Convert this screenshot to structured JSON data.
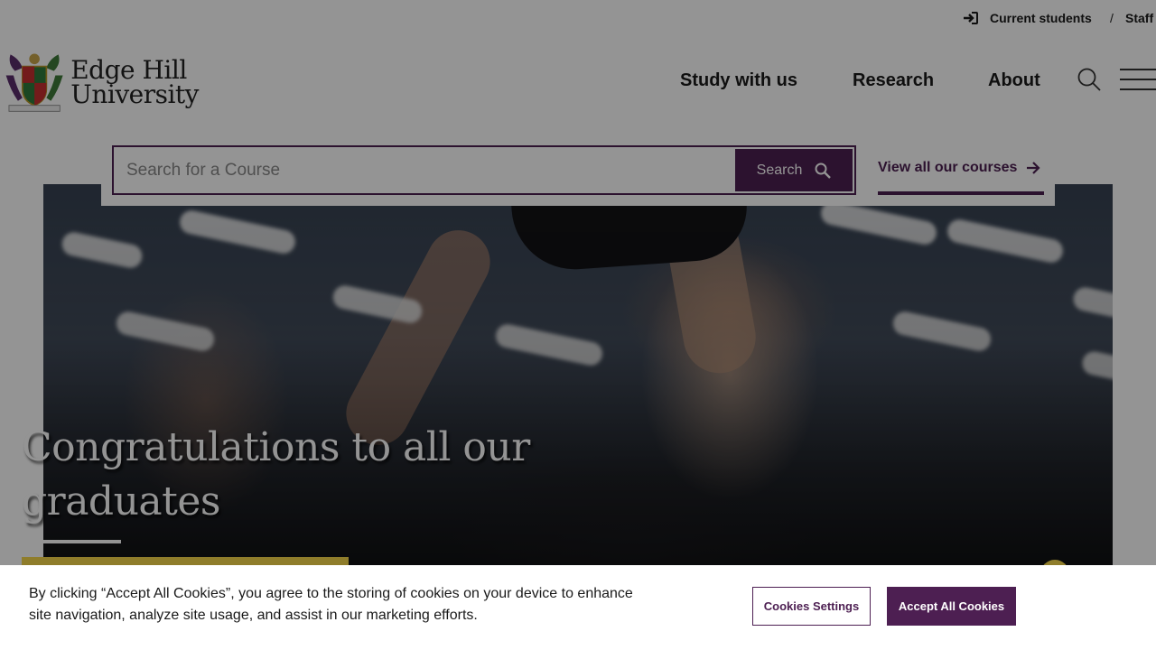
{
  "utility": {
    "current_students": "Current students",
    "separator": "/",
    "staff": "Staff"
  },
  "logo": {
    "line1": "Edge Hill",
    "line2": "University"
  },
  "nav": {
    "study": "Study with us",
    "research": "Research",
    "about": "About"
  },
  "course_search": {
    "placeholder": "Search for a Course",
    "button_label": "Search",
    "view_all": "View all our courses"
  },
  "hero": {
    "title": "Congratulations to all our graduates"
  },
  "cookie": {
    "message": "By clicking “Accept All Cookies”, you agree to the storing of cookies on your device to enhance site navigation, analyze site usage, and assist in our marketing efforts.",
    "settings_label": "Cookies Settings",
    "accept_label": "Accept All Cookies"
  },
  "colors": {
    "brand_purple": "#4d1f52",
    "accent_yellow": "#f6d84a",
    "overlay": "rgba(0,0,0,0.42)"
  },
  "icons": [
    "sign-in-icon",
    "university-crest-icon",
    "search-icon",
    "hamburger-menu-icon",
    "arrow-right-icon"
  ]
}
